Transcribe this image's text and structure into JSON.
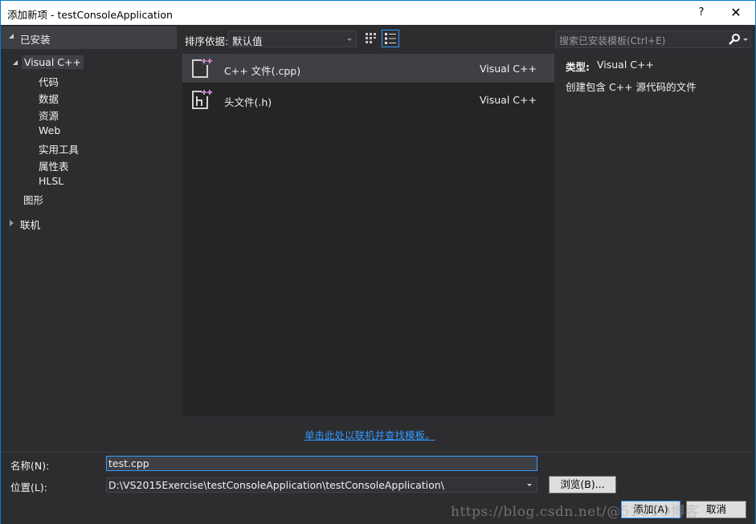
{
  "window": {
    "title": "添加新项 - testConsoleApplication",
    "help_label": "?",
    "close_label": "✕"
  },
  "left_panel": {
    "header": "已安装",
    "tree": [
      {
        "label": "Visual C++",
        "level": 0,
        "expanded": true,
        "selected": true
      },
      {
        "label": "代码",
        "level": 1
      },
      {
        "label": "数据",
        "level": 1
      },
      {
        "label": "资源",
        "level": 1
      },
      {
        "label": "Web",
        "level": 1
      },
      {
        "label": "实用工具",
        "level": 1
      },
      {
        "label": "属性表",
        "level": 1
      },
      {
        "label": "HLSL",
        "level": 1
      },
      {
        "label": "图形",
        "level": 0
      }
    ],
    "online": {
      "label": "联机",
      "expanded": false
    }
  },
  "toolbar": {
    "sort_label": "排序依据:",
    "sort_value": "默认值",
    "view_grid_icon": "grid-view-icon",
    "view_list_icon": "list-view-icon",
    "active_view": "list"
  },
  "search": {
    "placeholder": "搜索已安装模板(Ctrl+E)",
    "icon": "search-icon"
  },
  "templates": [
    {
      "name": "C++ 文件(.cpp)",
      "language": "Visual C++",
      "icon": "cpp-file-icon",
      "selected": true
    },
    {
      "name": "头文件(.h)",
      "language": "Visual C++",
      "icon": "header-file-icon",
      "selected": false
    }
  ],
  "details": {
    "type_label": "类型:",
    "type_value": "Visual C++",
    "description": "创建包含 C++ 源代码的文件"
  },
  "online_link": "单击此处以联机并查找模板。",
  "form": {
    "name_label": "名称(N):",
    "name_value": "test.cpp",
    "location_label": "位置(L):",
    "location_value": "D:\\VS2015Exercise\\testConsoleApplication\\testConsoleApplication\\",
    "browse_label": "浏览(B)...",
    "add_label": "添加(A)",
    "cancel_label": "取消"
  },
  "watermark": "https://blog.csdn.net/@51CTO博客",
  "colors": {
    "accent": "#007acc",
    "link": "#3399ff",
    "background": "#2d2d30",
    "list_background": "#252526",
    "selection": "#3f3f46",
    "icon_plus": "#c586c0"
  }
}
